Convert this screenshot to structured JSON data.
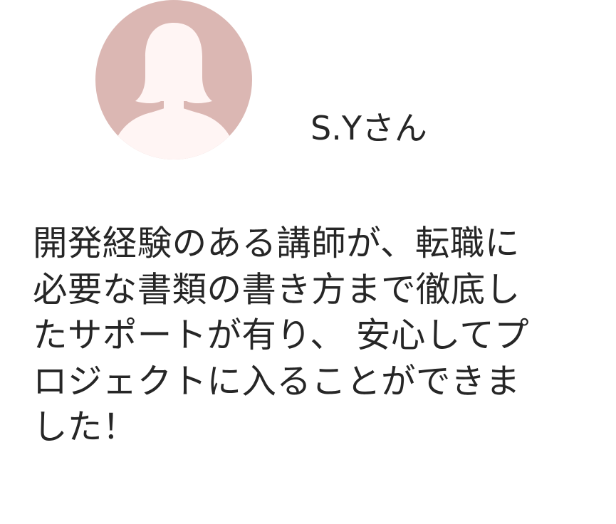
{
  "profile": {
    "avatar_icon": "person-silhouette-icon",
    "avatar_bg_color": "#dbb7b3",
    "avatar_figure_color": "#fff5f4",
    "name": "S.Yさん"
  },
  "testimonial": {
    "lines": [
      "開発経験のある講師が、転職に",
      "必要な書類の書き方まで徹底し",
      "たサポートが有り、 安心してプ",
      "ロジェクトに入ることができま",
      "した！"
    ]
  }
}
